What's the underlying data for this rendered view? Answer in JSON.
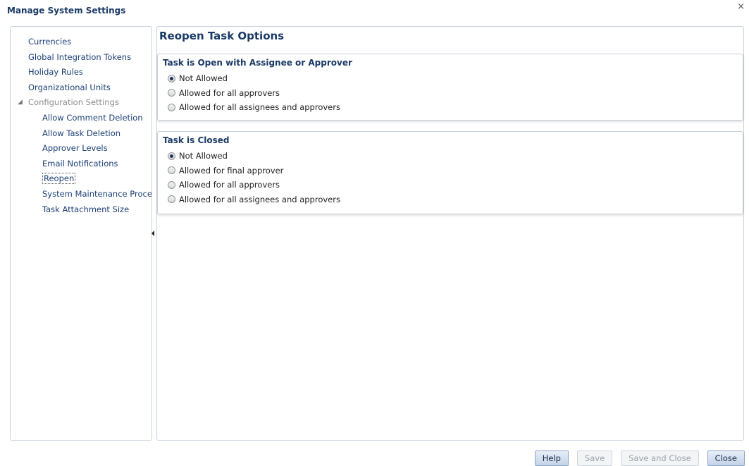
{
  "window": {
    "title": "Manage System Settings",
    "close_glyph": "×"
  },
  "nav": {
    "items": [
      {
        "label": "Currencies"
      },
      {
        "label": "Global Integration Tokens"
      },
      {
        "label": "Holiday Rules"
      },
      {
        "label": "Organizational Units"
      }
    ],
    "group": {
      "label": "Configuration Settings",
      "expanded": true,
      "children": [
        {
          "label": "Allow Comment Deletion"
        },
        {
          "label": "Allow Task Deletion"
        },
        {
          "label": "Approver Levels"
        },
        {
          "label": "Email Notifications"
        },
        {
          "label": "Reopen",
          "selected": true
        },
        {
          "label": "System Maintenance Proces"
        },
        {
          "label": "Task Attachment Size"
        }
      ]
    }
  },
  "main": {
    "heading": "Reopen Task Options",
    "sections": [
      {
        "title": "Task is Open with Assignee or Approver",
        "options": [
          {
            "label": "Not Allowed",
            "checked": true
          },
          {
            "label": "Allowed for all approvers",
            "checked": false
          },
          {
            "label": "Allowed for all assignees and approvers",
            "checked": false
          }
        ]
      },
      {
        "title": "Task is Closed",
        "options": [
          {
            "label": "Not Allowed",
            "checked": true
          },
          {
            "label": "Allowed for final approver",
            "checked": false
          },
          {
            "label": "Allowed for all approvers",
            "checked": false
          },
          {
            "label": "Allowed for all assignees and approvers",
            "checked": false
          }
        ]
      }
    ]
  },
  "footer": {
    "help_label": "Help",
    "save_label": "Save",
    "save_close_label": "Save and Close",
    "close_label": "Close"
  },
  "colors": {
    "heading": "#1a3b66",
    "link": "#1c3f77",
    "disabled_text": "#9aa3ad"
  },
  "icons": {
    "group_toggle": "collapse-triangle-icon",
    "splitter": "collapse-left-arrow-icon"
  }
}
